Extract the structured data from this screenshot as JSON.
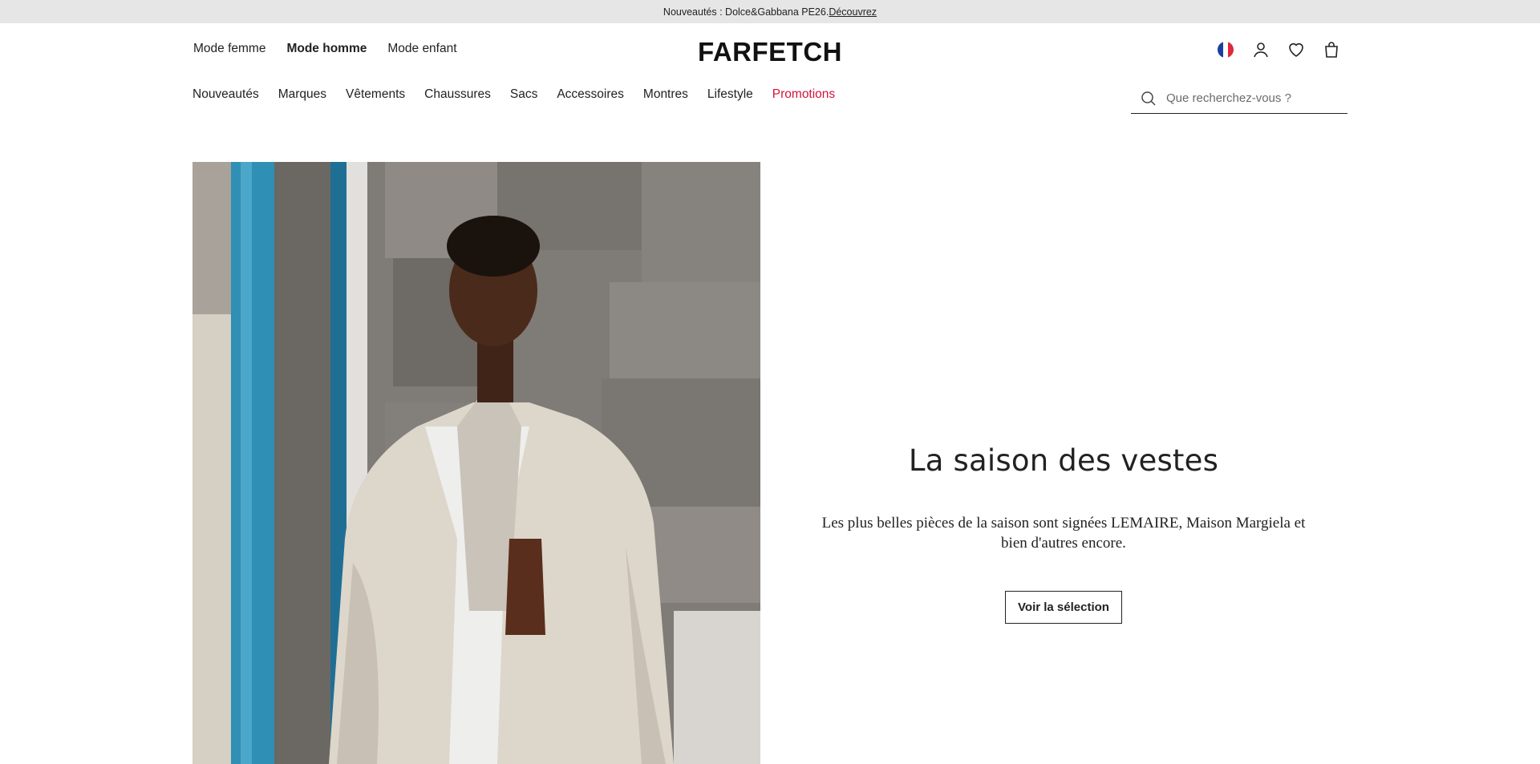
{
  "announcement": {
    "text": "Nouveautés : Dolce&Gabbana PE26.",
    "link": "Découvrez"
  },
  "gender_nav": [
    {
      "label": "Mode femme",
      "active": false
    },
    {
      "label": "Mode homme",
      "active": true
    },
    {
      "label": "Mode enfant",
      "active": false
    }
  ],
  "logo": "FARFETCH",
  "icons": {
    "country": "france-flag-icon",
    "account": "account-icon",
    "wishlist": "heart-icon",
    "bag": "shopping-bag-icon"
  },
  "category_nav": [
    "Nouveautés",
    "Marques",
    "Vêtements",
    "Chaussures",
    "Sacs",
    "Accessoires",
    "Montres",
    "Lifestyle",
    "Promotions"
  ],
  "colors": {
    "promo": "#d4143a",
    "announce_bg": "#e6e6e6",
    "text": "#222222"
  },
  "search": {
    "placeholder": "Que recherchez-vous ?"
  },
  "hero": {
    "title": "La saison des vestes",
    "description": "Les plus belles pièces de la saison sont signées LEMAIRE, Maison Margiela et bien d'autres encore.",
    "button": "Voir la sélection"
  }
}
